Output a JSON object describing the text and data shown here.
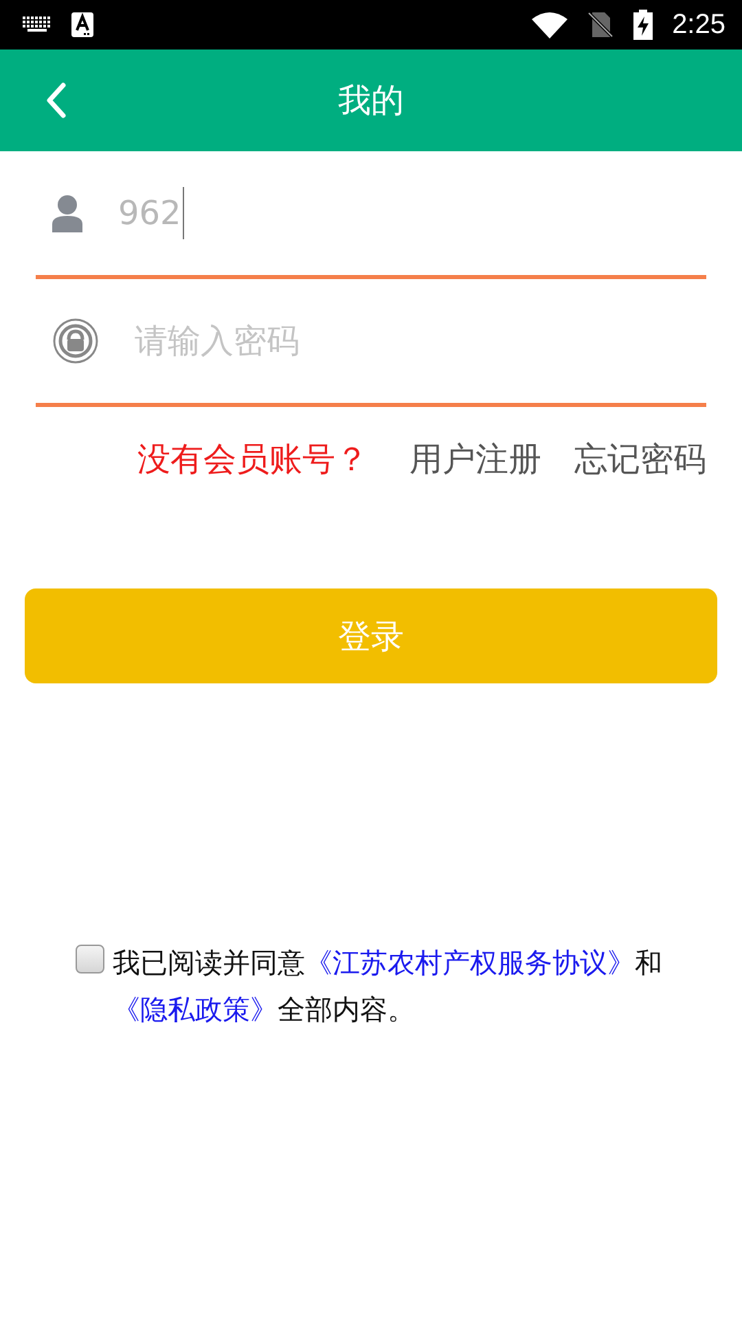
{
  "status_bar": {
    "time": "2:25"
  },
  "header": {
    "title": "我的"
  },
  "login_form": {
    "username": {
      "value": "962"
    },
    "password": {
      "placeholder": "请输入密码"
    }
  },
  "links": [
    {
      "kind": "prompt",
      "label": "没有会员账号？"
    },
    {
      "kind": "link",
      "label": "用户注册"
    },
    {
      "kind": "link",
      "label": "忘记密码"
    }
  ],
  "login_button": {
    "label": "登录"
  },
  "agreement": {
    "checked": false,
    "parts": [
      {
        "kind": "text",
        "text": "我已阅读并同意"
      },
      {
        "kind": "link",
        "text": "《江苏农村产权服务协议》"
      },
      {
        "kind": "text",
        "text": "和"
      },
      {
        "kind": "link",
        "text": "《隐私政策》"
      },
      {
        "kind": "text",
        "text": "全部内容。"
      }
    ]
  }
}
